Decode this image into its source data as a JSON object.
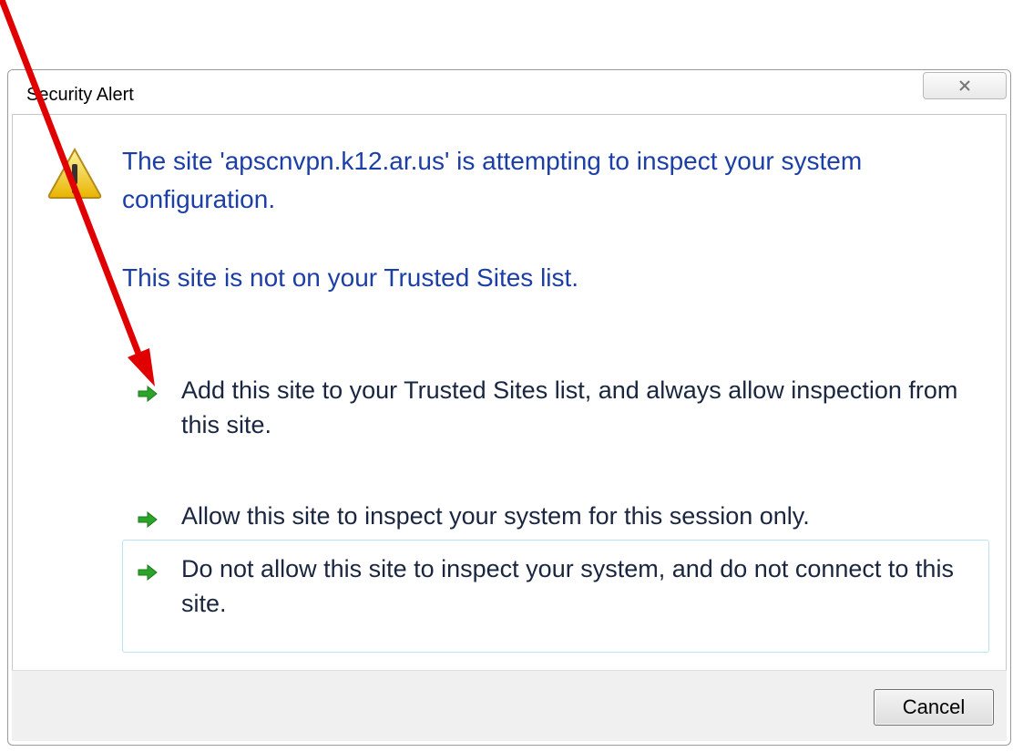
{
  "dialog": {
    "title": "Security Alert",
    "close_icon": "close-icon",
    "warning_icon": "warning-icon",
    "message_line1": "The site 'apscnvpn.k12.ar.us' is attempting to inspect your system configuration.",
    "message_line2": "This site is not on your Trusted Sites list.",
    "options": [
      {
        "label": "Add this site to your Trusted Sites list, and always allow inspection from this site.",
        "icon": "green-arrow-icon"
      },
      {
        "label": "Allow this site to inspect your system for this session only.",
        "icon": "green-arrow-icon"
      },
      {
        "label": "Do not allow this site to inspect your system, and do not connect to this site.",
        "icon": "green-arrow-icon"
      }
    ],
    "cancel_label": "Cancel"
  },
  "colors": {
    "message_text": "#1c3fa6",
    "option_text": "#1a2640",
    "annotation_arrow": "#e00000",
    "option_arrow": "#2aa52a",
    "footer_bg": "#f0f0f0"
  }
}
